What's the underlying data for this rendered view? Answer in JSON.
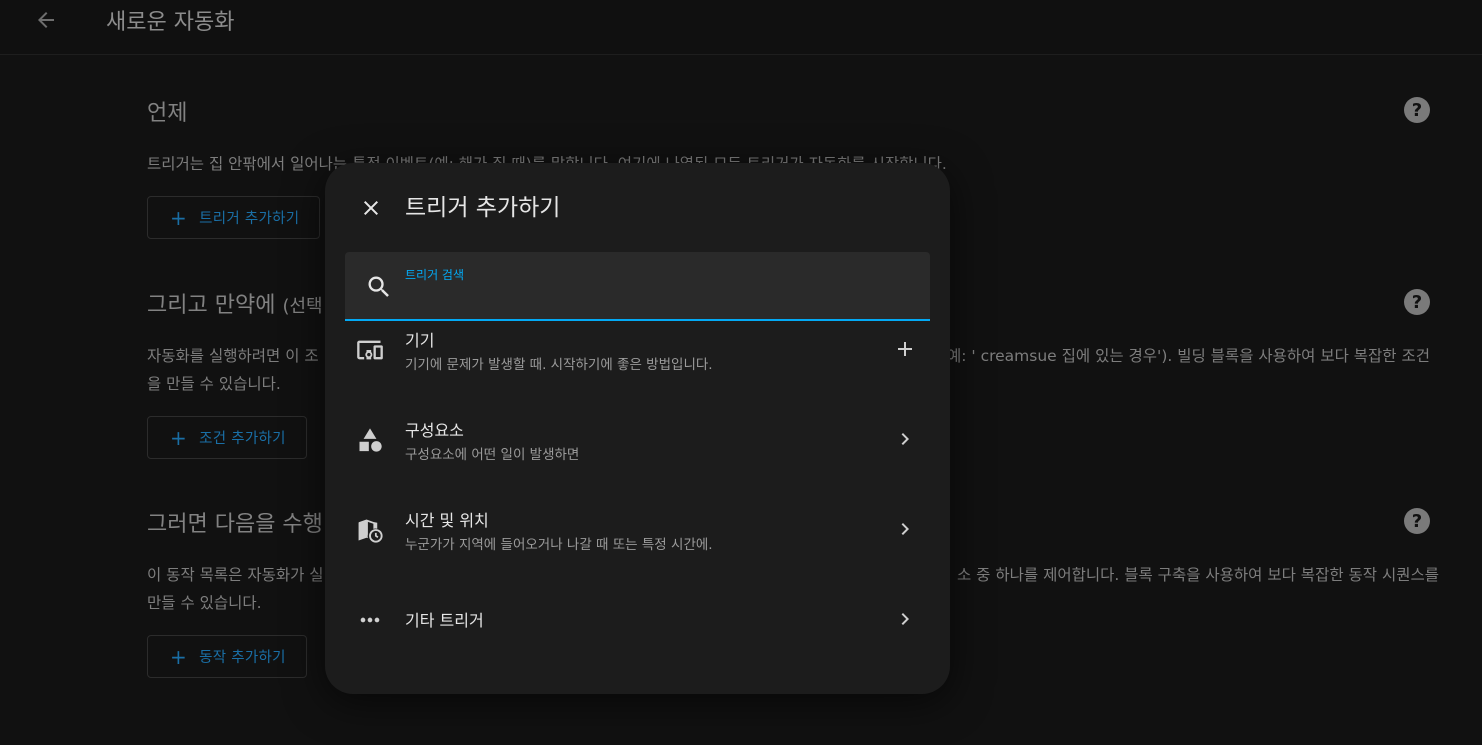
{
  "header": {
    "title": "새로운 자동화",
    "back_icon": "arrow-left-icon"
  },
  "sections": [
    {
      "title": "언제",
      "optional": "",
      "description": "트리거는 집 안팎에서 일어나는 특정 이벤트(예: 해가 질 때)를 말합니다. 여기에 나열된 모든 트리거가 자동화를 시작합니다.",
      "button_label": "트리거 추가하기"
    },
    {
      "title": "그리고 만약에",
      "optional": "(선택",
      "description": "자동화를 실행하려면 이 조",
      "description_tail": "예: ' creamsue 집에 있는 경우'). 빌딩 블록을 사용하여 보다 복잡한 조건",
      "description_line2": "을 만들 수 있습니다.",
      "button_label": "조건 추가하기"
    },
    {
      "title": "그러면 다음을 수행",
      "optional": "",
      "description": "이 동작 목록은 자동화가 실",
      "description_tail": "소 중 하나를 제어합니다. 블록 구축을 사용하여 보다 복잡한 동작 시퀀스를",
      "description_line2": "만들 수 있습니다.",
      "button_label": "동작 추가하기"
    }
  ],
  "dialog": {
    "title": "트리거 추가하기",
    "search_label": "트리거 검색",
    "search_value": "",
    "items": [
      {
        "title": "기기",
        "subtitle": "기기에 문제가 발생할 때. 시작하기에 좋은 방법입니다.",
        "icon": "devices-icon",
        "trail": "plus-icon"
      },
      {
        "title": "구성요소",
        "subtitle": "구성요소에 어떤 일이 발생하면",
        "icon": "shapes-icon",
        "trail": "chevron-right-icon"
      },
      {
        "title": "시간 및 위치",
        "subtitle": "누군가가 지역에 들어오거나 나갈 때 또는 특정 시간에.",
        "icon": "map-clock-icon",
        "trail": "chevron-right-icon"
      },
      {
        "title": "기타 트리거",
        "subtitle": "",
        "icon": "dots-horizontal-icon",
        "trail": "chevron-right-icon"
      }
    ]
  },
  "colors": {
    "accent": "#03a9f4",
    "button_text": "#1a6fa6",
    "dialog_bg": "#1c1c1c",
    "page_bg": "#111111"
  }
}
